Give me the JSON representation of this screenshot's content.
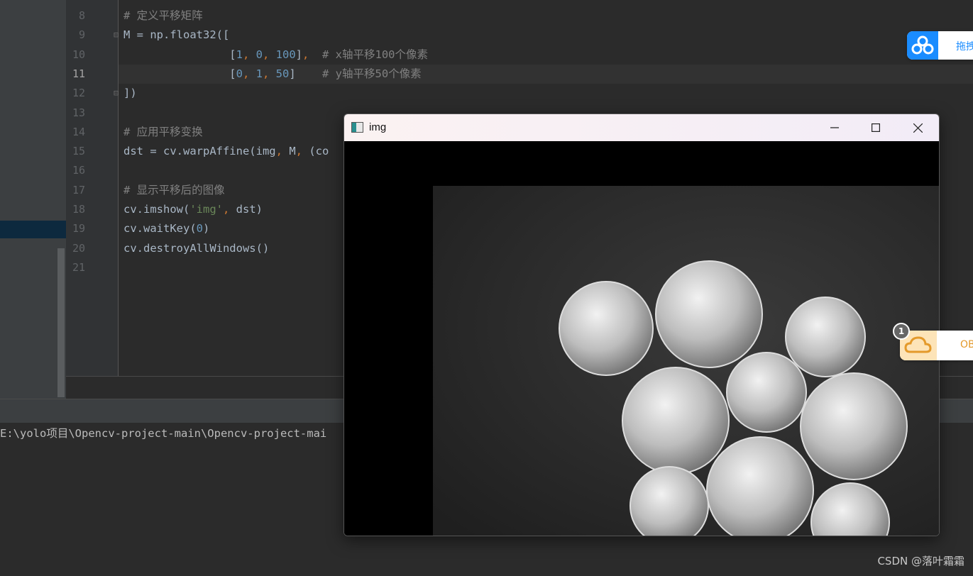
{
  "editor": {
    "lines": [
      {
        "num": "8",
        "current": false,
        "tokens": [
          {
            "t": "# 定义平移矩阵",
            "c": "com"
          }
        ]
      },
      {
        "num": "9",
        "current": false,
        "fold": true,
        "tokens": [
          {
            "t": "M = np.float32([",
            "c": ""
          }
        ]
      },
      {
        "num": "10",
        "current": false,
        "tokens": [
          {
            "t": "                [",
            "c": ""
          },
          {
            "t": "1",
            "c": "num"
          },
          {
            "t": ", ",
            "c": "punc"
          },
          {
            "t": "0",
            "c": "num"
          },
          {
            "t": ", ",
            "c": "punc"
          },
          {
            "t": "100",
            "c": "num"
          },
          {
            "t": "]",
            "c": ""
          },
          {
            "t": ",",
            "c": "punc"
          },
          {
            "t": "  # x轴平移100个像素",
            "c": "com"
          }
        ]
      },
      {
        "num": "11",
        "current": true,
        "tokens": [
          {
            "t": "                [",
            "c": ""
          },
          {
            "t": "0",
            "c": "num"
          },
          {
            "t": ", ",
            "c": "punc"
          },
          {
            "t": "1",
            "c": "num"
          },
          {
            "t": ", ",
            "c": "punc"
          },
          {
            "t": "50",
            "c": "num"
          },
          {
            "t": "]    ",
            "c": ""
          },
          {
            "t": "# y轴平移50个像素",
            "c": "com"
          }
        ]
      },
      {
        "num": "12",
        "current": false,
        "fold": true,
        "tokens": [
          {
            "t": "])",
            "c": ""
          }
        ]
      },
      {
        "num": "13",
        "current": false,
        "tokens": []
      },
      {
        "num": "14",
        "current": false,
        "tokens": [
          {
            "t": "# 应用平移变换",
            "c": "com"
          }
        ]
      },
      {
        "num": "15",
        "current": false,
        "tokens": [
          {
            "t": "dst = cv.warpAffine(img",
            "c": ""
          },
          {
            "t": ", ",
            "c": "punc"
          },
          {
            "t": "M",
            "c": ""
          },
          {
            "t": ", ",
            "c": "punc"
          },
          {
            "t": "(co",
            "c": ""
          }
        ]
      },
      {
        "num": "16",
        "current": false,
        "tokens": []
      },
      {
        "num": "17",
        "current": false,
        "tokens": [
          {
            "t": "# 显示平移后的图像",
            "c": "com"
          }
        ]
      },
      {
        "num": "18",
        "current": false,
        "tokens": [
          {
            "t": "cv.imshow(",
            "c": ""
          },
          {
            "t": "'img'",
            "c": "str"
          },
          {
            "t": ", ",
            "c": "punc"
          },
          {
            "t": "dst)",
            "c": ""
          }
        ]
      },
      {
        "num": "19",
        "current": false,
        "tokens": [
          {
            "t": "cv.waitKey(",
            "c": ""
          },
          {
            "t": "0",
            "c": "num"
          },
          {
            "t": ")",
            "c": ""
          }
        ]
      },
      {
        "num": "20",
        "current": false,
        "tokens": [
          {
            "t": "cv.destroyAllWindows()",
            "c": ""
          }
        ]
      },
      {
        "num": "21",
        "current": false,
        "tokens": []
      }
    ]
  },
  "run": {
    "path": "E:\\yolo项目\\Opencv-project-main\\Opencv-project-mai"
  },
  "image_window": {
    "title": "img",
    "icons": [
      "app-icon",
      "minimize-icon",
      "maximize-icon",
      "close-icon"
    ]
  },
  "widgets": {
    "baidu_text": "拖拽",
    "cloud_text": "OB",
    "cloud_badge": "1"
  },
  "watermark": "CSDN @落叶霜霜",
  "colors": {
    "editor_bg": "#2b2b2b",
    "panel_bg": "#3c3f41",
    "comment": "#808080",
    "number": "#6897bb",
    "string": "#6a8759",
    "keyword_punct": "#cc7832",
    "baidu_blue": "#1a8cff",
    "cloud_orange": "#e49a2b"
  }
}
